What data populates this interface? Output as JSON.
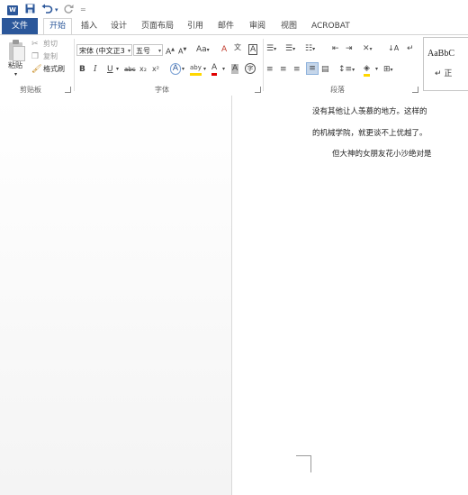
{
  "qat": {
    "app_icon": "W",
    "undo_icon": "undo-icon",
    "redo_icon": "redo-icon",
    "more_glyph": "="
  },
  "tabs": [
    {
      "label": "文件"
    },
    {
      "label": "开始"
    },
    {
      "label": "插入"
    },
    {
      "label": "设计"
    },
    {
      "label": "页面布局"
    },
    {
      "label": "引用"
    },
    {
      "label": "邮件"
    },
    {
      "label": "审阅"
    },
    {
      "label": "视图"
    },
    {
      "label": "ACROBAT"
    }
  ],
  "ribbon": {
    "clipboard": {
      "paste": "粘贴",
      "cut": "剪切",
      "copy": "复制",
      "format_painter": "格式刷",
      "group": "剪贴板"
    },
    "font": {
      "font_name": "宋体 (中文正3",
      "font_size": "五号",
      "group": "字体",
      "grow": "A",
      "shrink": "A",
      "case": "Aa",
      "clear": "A",
      "phonetic": "文",
      "border_char": "A",
      "bold": "B",
      "italic": "I",
      "underline": "U",
      "strike": "abc",
      "sub": "x₂",
      "sup": "x²",
      "effects": "A",
      "highlight": "aby",
      "font_color": "A",
      "shading": "A",
      "circle": "字"
    },
    "paragraph": {
      "group": "段落"
    },
    "styles": {
      "sample": "AaBbC",
      "name": "↵ 正"
    }
  },
  "document": {
    "lines": [
      "没有其他让人羡慕的地方。这样的",
      "的机械学院，就更谈不上优越了。",
      "但大神的女朋友花小沙绝对是"
    ]
  },
  "colors": {
    "accent": "#2b579a",
    "highlight": "#ffd700",
    "font_red": "#e00000"
  }
}
